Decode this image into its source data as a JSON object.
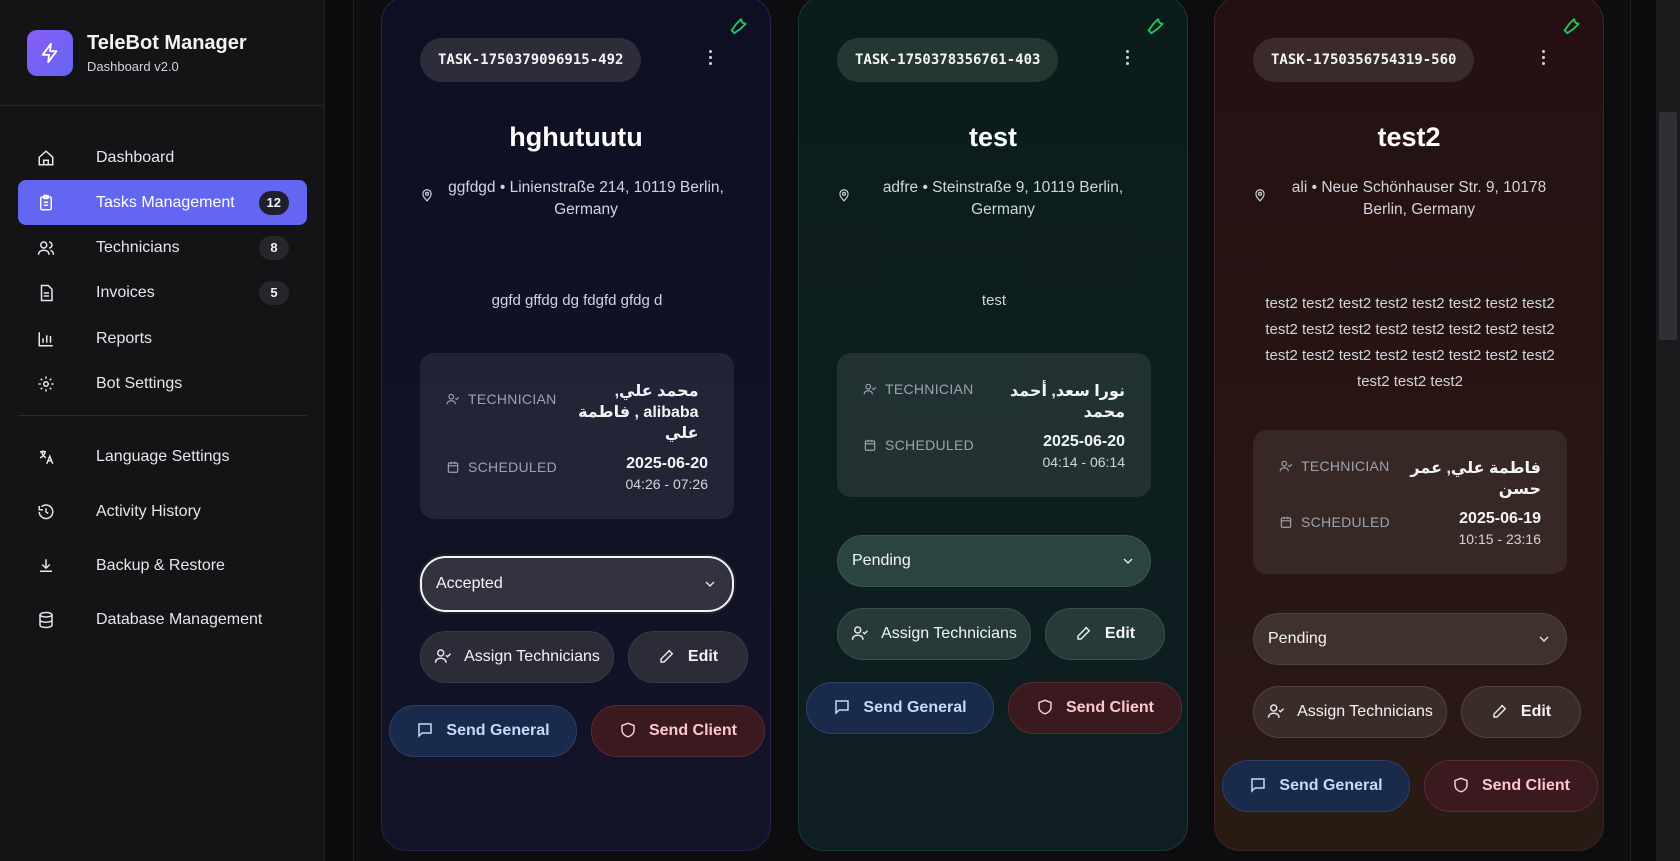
{
  "app": {
    "title": "TeleBot Manager",
    "subtitle": "Dashboard v2.0"
  },
  "sidebar": {
    "items": [
      {
        "label": "Dashboard",
        "icon": "home-icon"
      },
      {
        "label": "Tasks Management",
        "icon": "clipboard-icon",
        "badge": "12",
        "active": true
      },
      {
        "label": "Technicians",
        "icon": "users-icon",
        "badge": "8"
      },
      {
        "label": "Invoices",
        "icon": "file-icon",
        "badge": "5"
      },
      {
        "label": "Reports",
        "icon": "bar-chart-icon"
      },
      {
        "label": "Bot Settings",
        "icon": "gear-icon"
      },
      {
        "label": "Language Settings",
        "icon": "translate-icon"
      },
      {
        "label": "Activity History",
        "icon": "history-icon"
      },
      {
        "label": "Backup & Restore",
        "icon": "download-icon"
      },
      {
        "label": "Database Management",
        "icon": "database-icon"
      }
    ]
  },
  "labels": {
    "technician": "TECHNICIAN",
    "scheduled": "SCHEDULED",
    "assign": "Assign Technicians",
    "edit": "Edit",
    "send_general": "Send General",
    "send_client": "Send Client"
  },
  "tasks": [
    {
      "id": "TASK-1750379096915-492",
      "title": "hghutuutu",
      "location": "ggfdgd • Linienstraße 214, 10119 Berlin, Germany",
      "description": "ggfd gffdg dg fdgfd gfdg d",
      "technicians": "محمد علي, alibaba , فاطمة علي",
      "date": "2025-06-20",
      "time": "04:26 - 07:26",
      "status": "Accepted"
    },
    {
      "id": "TASK-1750378356761-403",
      "title": "test",
      "location": "adfre • Steinstraße 9, 10119 Berlin, Germany",
      "description": "test",
      "technicians": "نورا سعد, أحمد محمد",
      "date": "2025-06-20",
      "time": "04:14 - 06:14",
      "status": "Pending"
    },
    {
      "id": "TASK-1750356754319-560",
      "title": "test2",
      "location": "ali • Neue Schönhauser Str. 9, 10178 Berlin, Germany",
      "description": "test2 test2 test2 test2 test2 test2 test2 test2 test2 test2 test2 test2 test2 test2 test2 test2 test2 test2 test2 test2 test2 test2 test2 test2 test2 test2 test2",
      "technicians": "فاطمة علي, عمر حسن",
      "date": "2025-06-19",
      "time": "10:15 - 23:16",
      "status": "Pending"
    }
  ],
  "colors": {
    "accent": "#6366f1",
    "wrench": "#22c55e"
  }
}
